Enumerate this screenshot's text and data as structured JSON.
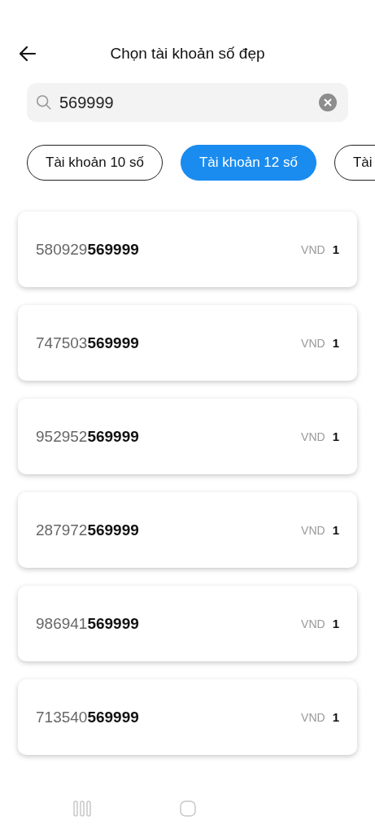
{
  "header": {
    "title": "Chọn tài khoản số đẹp"
  },
  "search": {
    "value": "569999"
  },
  "tabs": [
    {
      "label": "Tài khoản 10 số",
      "selected": false
    },
    {
      "label": "Tài khoản 12 số",
      "selected": true
    },
    {
      "label": "Tài",
      "selected": false
    }
  ],
  "accounts": [
    {
      "number": "580929**569999**",
      "currency": "VND",
      "price": "1"
    },
    {
      "number": "747503**569999**",
      "currency": "VND",
      "price": "1"
    },
    {
      "number": "952952**569999**",
      "currency": "VND",
      "price": "1"
    },
    {
      "number": "287972**569999**",
      "currency": "VND",
      "price": "1"
    },
    {
      "number": "986941**569999**",
      "currency": "VND",
      "price": "1"
    },
    {
      "number": "713540**569999**",
      "currency": "VND",
      "price": "1"
    }
  ]
}
